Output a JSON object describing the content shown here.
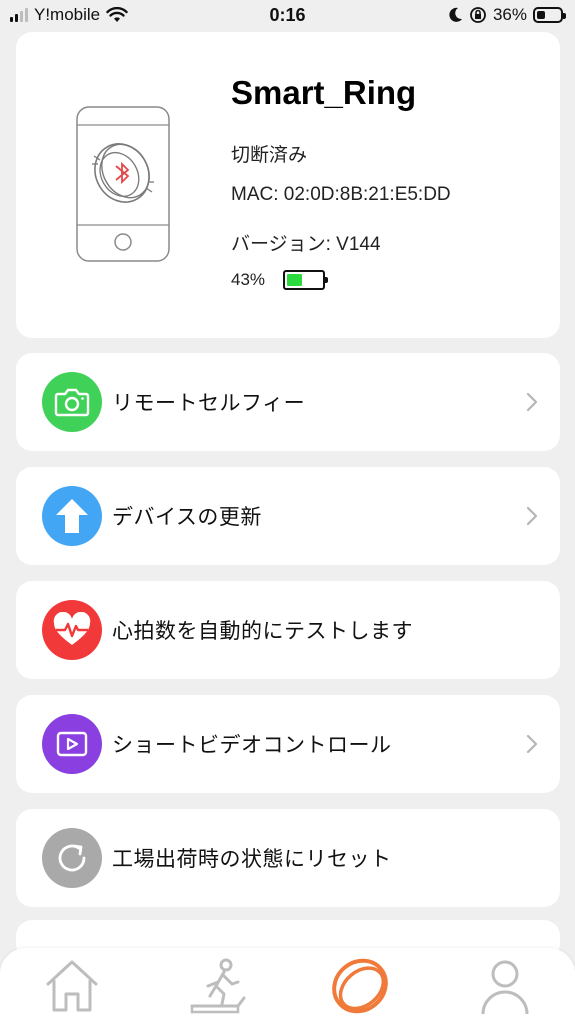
{
  "status_bar": {
    "carrier": "Y!mobile",
    "time": "0:16",
    "battery_percent": "36%"
  },
  "device": {
    "name": "Smart_Ring",
    "connection_status": "切断済み",
    "mac": "MAC: 02:0D:8B:21:E5:DD",
    "version": "バージョン: V144",
    "battery_percent": "43%",
    "battery_level": 0.43,
    "battery_color": "#2dd93e"
  },
  "menu": [
    {
      "label": "リモートセルフィー",
      "icon": "camera-icon",
      "color": "#3fd158",
      "has_chevron": true
    },
    {
      "label": "デバイスの更新",
      "icon": "upload-arrow-icon",
      "color": "#43a6f4",
      "has_chevron": true
    },
    {
      "label": "心拍数を自動的にテストします",
      "icon": "heart-rate-icon",
      "color": "#f2393a",
      "has_chevron": false
    },
    {
      "label": "ショートビデオコントロール",
      "icon": "video-play-icon",
      "color": "#8a3fe0",
      "has_chevron": true
    },
    {
      "label": "工場出荷時の状態にリセット",
      "icon": "reset-icon",
      "color": "#a9a9a9",
      "has_chevron": false
    }
  ],
  "tab_bar": {
    "tabs": [
      {
        "name": "home",
        "icon": "home-icon",
        "active": false
      },
      {
        "name": "activity",
        "icon": "treadmill-icon",
        "active": false
      },
      {
        "name": "device",
        "icon": "ring-icon",
        "active": true
      },
      {
        "name": "profile",
        "icon": "person-icon",
        "active": false
      }
    ],
    "active_color": "#f07a3a",
    "inactive_color": "#bdbdbd"
  }
}
